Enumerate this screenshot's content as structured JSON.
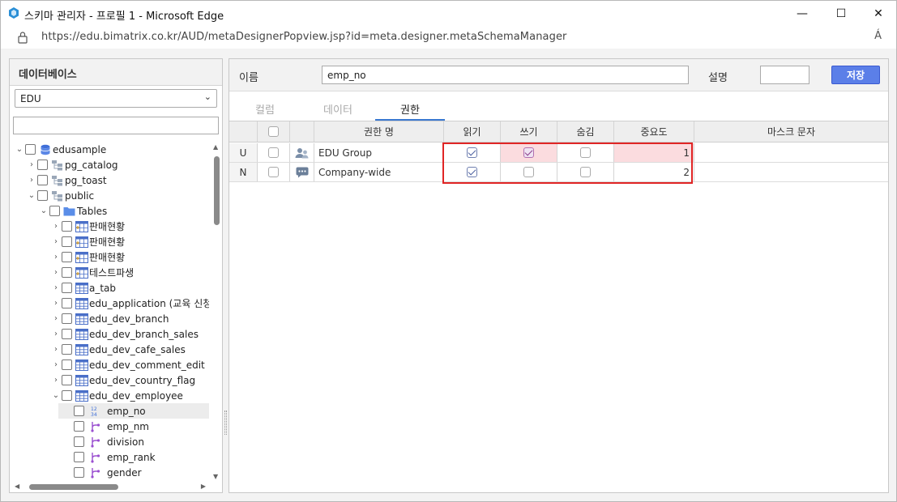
{
  "window": {
    "title": "스키마 관리자 - 프로필 1 - Microsoft Edge",
    "url": "https://edu.bimatrix.co.kr/AUD/metaDesignerPopview.jsp?id=meta.designer.metaSchemaManager",
    "minimize": "—",
    "maximize": "☐",
    "close": "✕",
    "read_aloud": "Á"
  },
  "left": {
    "header": "데이터베이스",
    "db_selected": "EDU",
    "search_value": "",
    "tree": [
      {
        "label": "edusample",
        "icon": "database-icon",
        "level": 0,
        "toggle": "open"
      },
      {
        "label": "pg_catalog",
        "icon": "schema-icon",
        "level": 1,
        "toggle": "closed"
      },
      {
        "label": "pg_toast",
        "icon": "schema-icon",
        "level": 1,
        "toggle": "closed"
      },
      {
        "label": "public",
        "icon": "schema-icon",
        "level": 1,
        "toggle": "open"
      },
      {
        "label": "Tables",
        "icon": "folder-icon",
        "level": 2,
        "toggle": "open"
      },
      {
        "label": "판매현황",
        "icon": "view-icon",
        "level": 3,
        "toggle": "closed"
      },
      {
        "label": "판매현황",
        "icon": "view-icon",
        "level": 3,
        "toggle": "closed"
      },
      {
        "label": "판매현황",
        "icon": "view-icon",
        "level": 3,
        "toggle": "closed"
      },
      {
        "label": "테스트파생",
        "icon": "view-icon",
        "level": 3,
        "toggle": "closed"
      },
      {
        "label": "a_tab",
        "icon": "table-icon",
        "level": 3,
        "toggle": "closed"
      },
      {
        "label": "edu_application (교육 신청",
        "icon": "table-icon",
        "level": 3,
        "toggle": "closed"
      },
      {
        "label": "edu_dev_branch",
        "icon": "table-icon",
        "level": 3,
        "toggle": "closed"
      },
      {
        "label": "edu_dev_branch_sales",
        "icon": "table-icon",
        "level": 3,
        "toggle": "closed"
      },
      {
        "label": "edu_dev_cafe_sales",
        "icon": "table-icon",
        "level": 3,
        "toggle": "closed"
      },
      {
        "label": "edu_dev_comment_edit",
        "icon": "table-icon",
        "level": 3,
        "toggle": "closed"
      },
      {
        "label": "edu_dev_country_flag",
        "icon": "table-icon",
        "level": 3,
        "toggle": "closed"
      },
      {
        "label": "edu_dev_employee",
        "icon": "table-icon",
        "level": 3,
        "toggle": "open"
      },
      {
        "label": "emp_no",
        "icon": "numeric-column-icon",
        "level": 4,
        "toggle": "none",
        "selected": true
      },
      {
        "label": "emp_nm",
        "icon": "text-column-icon",
        "level": 4,
        "toggle": "none"
      },
      {
        "label": "division",
        "icon": "text-column-icon",
        "level": 4,
        "toggle": "none"
      },
      {
        "label": "emp_rank",
        "icon": "text-column-icon",
        "level": 4,
        "toggle": "none"
      },
      {
        "label": "gender",
        "icon": "text-column-icon",
        "level": 4,
        "toggle": "none"
      }
    ]
  },
  "form": {
    "name_label": "이름",
    "name_value": "emp_no",
    "desc_label": "설명",
    "desc_value": "",
    "save_label": "저장"
  },
  "tabs": [
    {
      "label": "컬럼",
      "active": false
    },
    {
      "label": "데이터",
      "active": false
    },
    {
      "label": "권한",
      "active": true
    }
  ],
  "grid": {
    "columns": [
      "권한 명",
      "읽기",
      "쓰기",
      "숨김",
      "중요도",
      "마스크 문자"
    ],
    "rows": [
      {
        "type": "U",
        "icon": "group-icon",
        "name": "EDU Group",
        "read": true,
        "write": true,
        "hide": false,
        "importance": "1",
        "mask": "",
        "changed": true
      },
      {
        "type": "N",
        "icon": "company-icon",
        "name": "Company-wide",
        "read": true,
        "write": false,
        "hide": false,
        "importance": "2",
        "mask": "",
        "changed": false
      }
    ]
  },
  "colors": {
    "accent": "#5b7fe8",
    "highlight_border": "#e02525",
    "changed_cell": "#fbdcdf"
  }
}
